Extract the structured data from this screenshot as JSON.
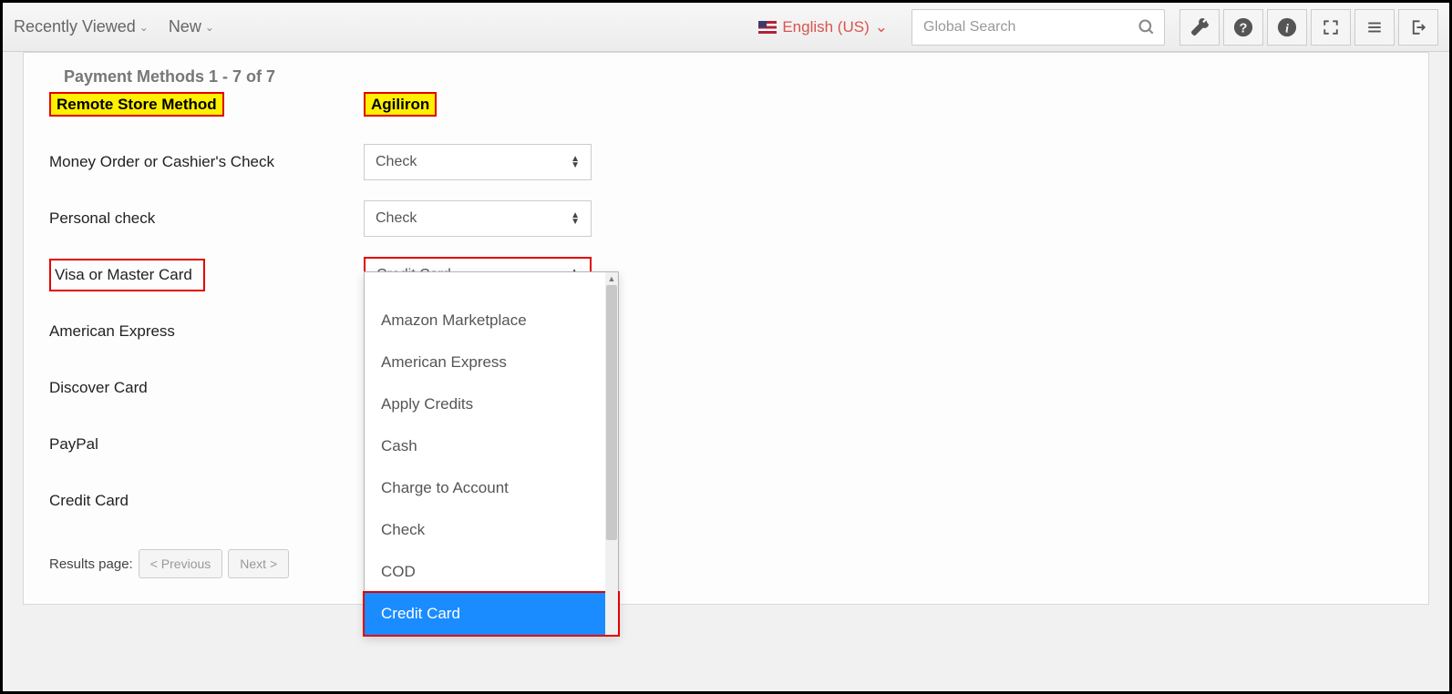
{
  "topbar": {
    "recently_viewed": "Recently Viewed",
    "new_menu": "New",
    "language": "English (US)",
    "search_placeholder": "Global Search"
  },
  "heading": "Payment Methods 1 - 7 of 7",
  "columns": {
    "remote": "Remote Store Method",
    "agiliron": "Agiliron"
  },
  "rows": [
    {
      "label": "Money Order or Cashier's Check",
      "value": "Check"
    },
    {
      "label": "Personal check",
      "value": "Check"
    },
    {
      "label": "Visa or Master Card",
      "value": "Credit Card"
    },
    {
      "label": "American Express",
      "value": ""
    },
    {
      "label": "Discover Card",
      "value": ""
    },
    {
      "label": "PayPal",
      "value": ""
    },
    {
      "label": "Credit Card",
      "value": ""
    }
  ],
  "dropdown_options": [
    "Amazon Marketplace",
    "American Express",
    "Apply Credits",
    "Cash",
    "Charge to Account",
    "Check",
    "COD",
    "Credit Card"
  ],
  "dropdown_selected": "Credit Card",
  "pager": {
    "label": "Results page:",
    "prev": "< Previous",
    "next": "Next >"
  }
}
